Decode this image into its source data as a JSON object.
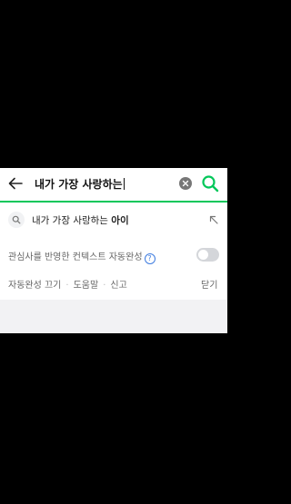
{
  "search": {
    "query": "내가 가장 사랑하는"
  },
  "suggestion": {
    "prefix": "내가 가장 사랑하는 ",
    "highlight": "아이"
  },
  "settings": {
    "autocomplete_label": "관심사를 반영한 컨텍스트 자동완성",
    "help_glyph": "?",
    "toggle_on": false
  },
  "links": {
    "autocomplete_off": "자동완성 끄기",
    "help": "도움말",
    "report": "신고",
    "separator": "·",
    "close": "닫기"
  },
  "colors": {
    "accent": "#03c75a",
    "help_blue": "#3f7de0",
    "toggle_off": "#d4d6da",
    "footer_gray": "#f2f2f4"
  },
  "icons": {
    "back": "back-arrow-icon",
    "clear": "clear-icon",
    "search": "search-icon",
    "suggestion": "magnifier-icon",
    "fill": "arrow-up-left-icon",
    "help": "question-icon"
  }
}
